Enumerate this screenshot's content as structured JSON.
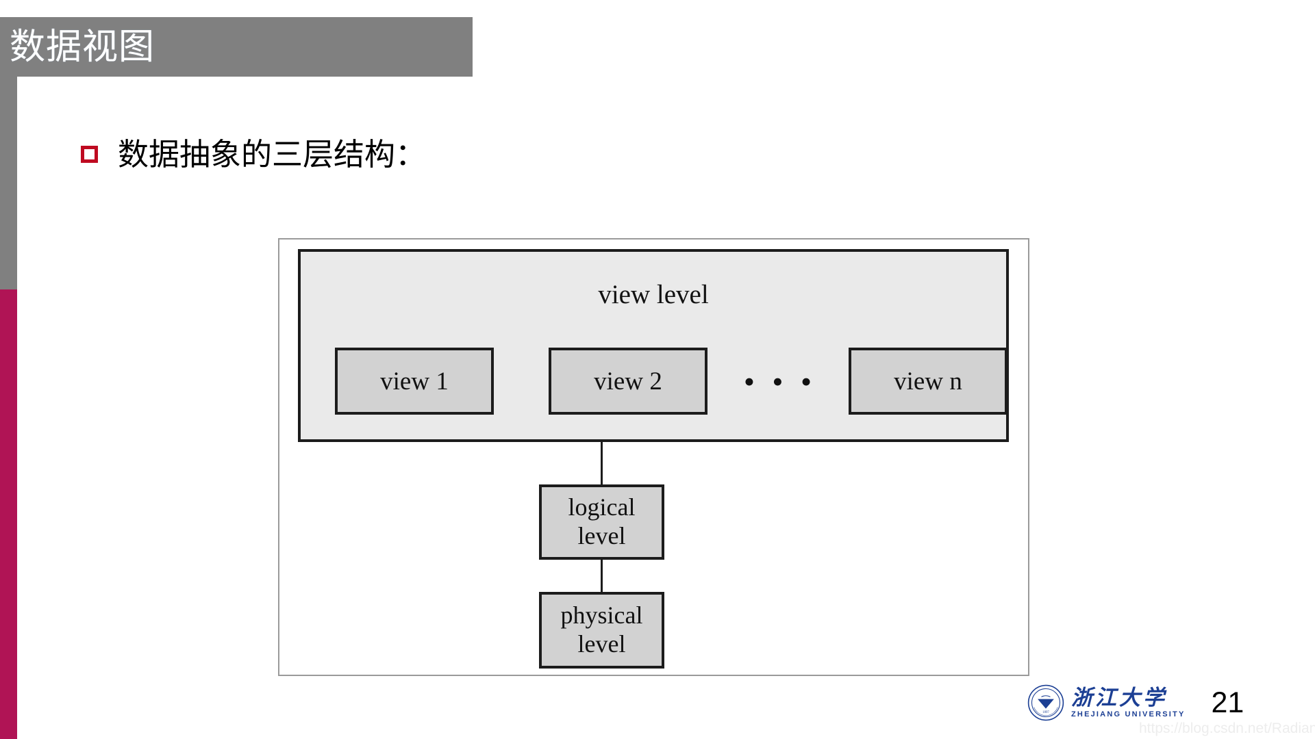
{
  "slide": {
    "title": "数据视图",
    "page_number": "21",
    "watermark": "https://blog.csdn.net/RadiantJeral",
    "bullet": {
      "marker": "square-bullet-icon",
      "text": "数据抽象的三层结构："
    }
  },
  "theme": {
    "title_band_color": "#808080",
    "sidebar_gray": "#808080",
    "sidebar_crimson": "#b01455",
    "bullet_marker_color": "#bf0a21",
    "diagram_panel_fill": "#eaeaea",
    "diagram_box_fill": "#d2d2d2",
    "diagram_stroke": "#1c1c1c",
    "logo_blue": "#1c3f94"
  },
  "diagram": {
    "name": "three-level-data-abstraction",
    "view_level": {
      "label": "view level",
      "views": [
        {
          "label": "view 1"
        },
        {
          "label": "view 2"
        },
        {
          "label": "view n"
        }
      ],
      "ellipsis": "• • •"
    },
    "logical_level": {
      "line1": "logical",
      "line2": "level"
    },
    "physical_level": {
      "line1": "physical",
      "line2": "level"
    }
  },
  "footer": {
    "university_cn": "浙江大学",
    "university_en": "ZHEJIANG UNIVERSITY"
  }
}
